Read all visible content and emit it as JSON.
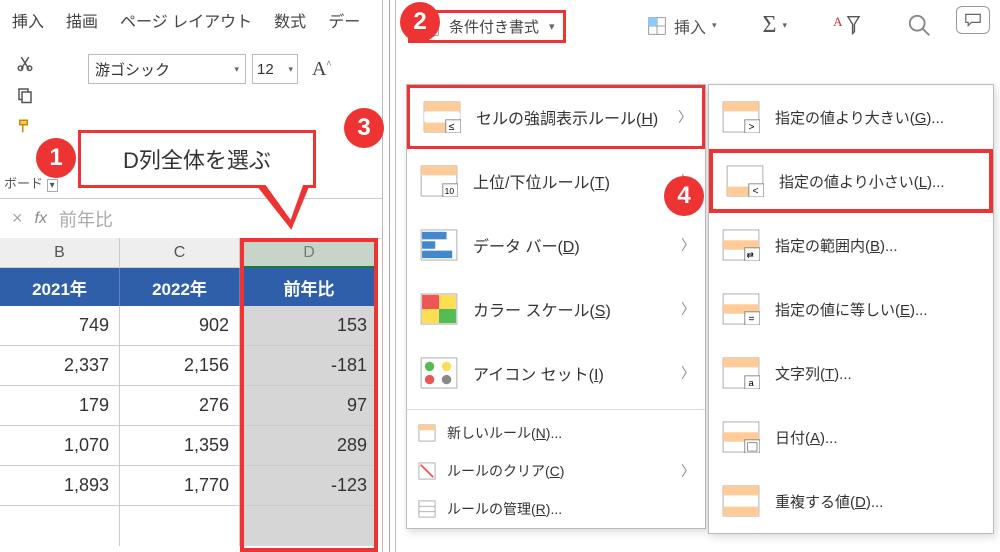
{
  "tabs": [
    "挿入",
    "描画",
    "ページ レイアウト",
    "数式",
    "デー"
  ],
  "ribbon": {
    "font_name": "游ゴシック",
    "font_size": "12",
    "section_label": "ボード"
  },
  "callout_text": "D列全体を選ぶ",
  "formula_bar": {
    "x_symbol": "×",
    "fx": "fx",
    "value": "前年比"
  },
  "table": {
    "col_letters": [
      "B",
      "C",
      "D"
    ],
    "headers": [
      "2021年",
      "2022年",
      "前年比"
    ],
    "rows": [
      [
        "749",
        "902",
        "153"
      ],
      [
        "2,337",
        "2,156",
        "-181"
      ],
      [
        "179",
        "276",
        "97"
      ],
      [
        "1,070",
        "1,359",
        "289"
      ],
      [
        "1,893",
        "1,770",
        "-123"
      ]
    ]
  },
  "cf_button_label": "条件付き書式",
  "right_tools": {
    "insert": "挿入",
    "sigma": "Σ"
  },
  "menu1": {
    "items": [
      {
        "label_pre": "セルの強調表示ルール(",
        "key": "H",
        "label_post": ")"
      },
      {
        "label_pre": "上位/下位ルール(",
        "key": "T",
        "label_post": ")"
      },
      {
        "label_pre": "データ バー(",
        "key": "D",
        "label_post": ")"
      },
      {
        "label_pre": "カラー スケール(",
        "key": "S",
        "label_post": ")"
      },
      {
        "label_pre": "アイコン セット(",
        "key": "I",
        "label_post": ")"
      }
    ],
    "small_items": [
      {
        "label_pre": "新しいルール(",
        "key": "N",
        "label_post": ")..."
      },
      {
        "label_pre": "ルールのクリア(",
        "key": "C",
        "label_post": ")"
      },
      {
        "label_pre": "ルールの管理(",
        "key": "R",
        "label_post": ")..."
      }
    ]
  },
  "menu2": {
    "items": [
      {
        "label_pre": "指定の値より大きい(",
        "key": "G",
        "label_post": ")..."
      },
      {
        "label_pre": "指定の値より小さい(",
        "key": "L",
        "label_post": ")..."
      },
      {
        "label_pre": "指定の範囲内(",
        "key": "B",
        "label_post": ")..."
      },
      {
        "label_pre": "指定の値に等しい(",
        "key": "E",
        "label_post": ")..."
      },
      {
        "label_pre": "文字列(",
        "key": "T",
        "label_post": ")..."
      },
      {
        "label_pre": "日付(",
        "key": "A",
        "label_post": ")..."
      },
      {
        "label_pre": "重複する値(",
        "key": "D",
        "label_post": ")..."
      }
    ]
  },
  "badges": [
    "1",
    "2",
    "3",
    "4"
  ],
  "arrow_glyph": "〉"
}
